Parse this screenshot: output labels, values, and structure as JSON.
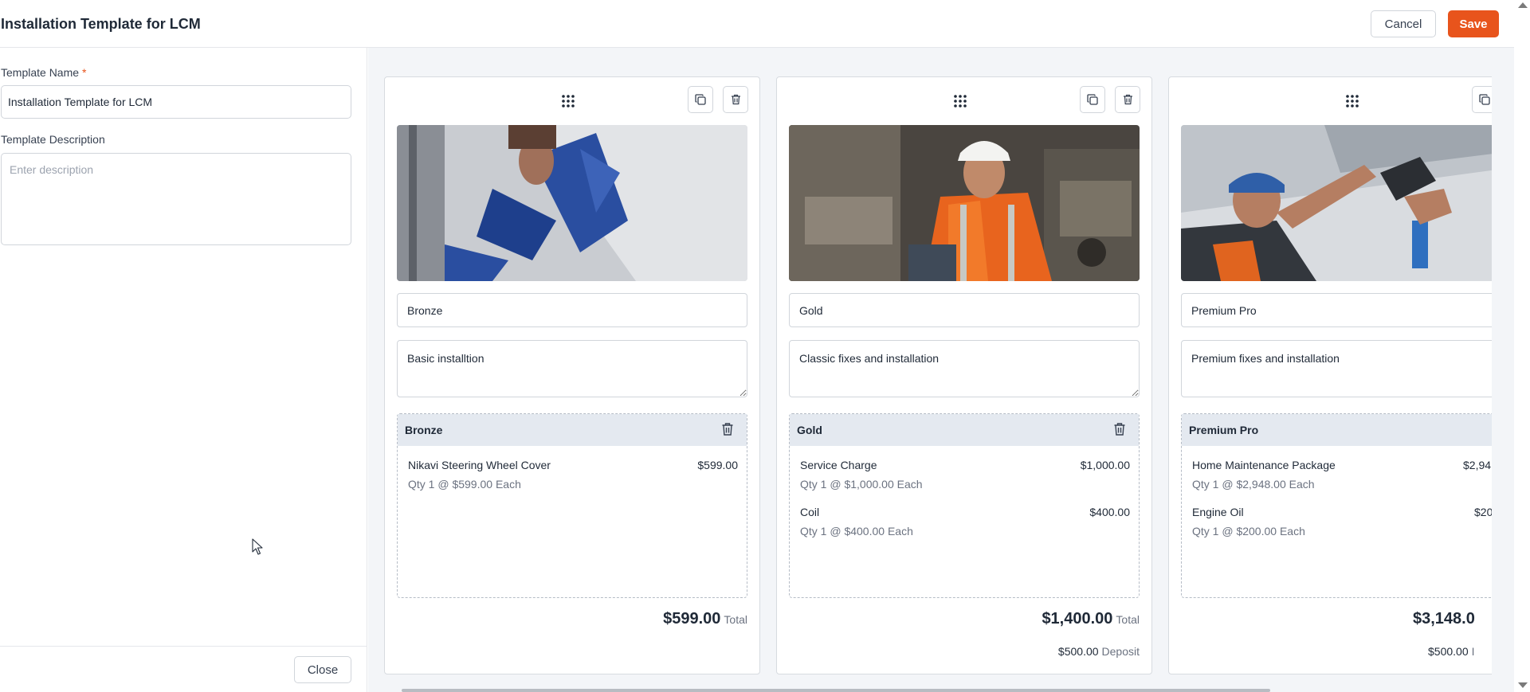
{
  "header": {
    "title": "Installation Template for LCM",
    "cancel_label": "Cancel",
    "save_label": "Save",
    "accent_color": "#e8541c"
  },
  "form": {
    "name_label": "Template Name",
    "required_mark": "*",
    "name_value": "Installation Template for LCM",
    "description_label": "Template Description",
    "description_value": "",
    "description_placeholder": "Enter description",
    "close_label": "Close"
  },
  "cards": [
    {
      "image": "technician-installing-signage-photo",
      "name_value": "Bronze",
      "description_value": "Basic installtion",
      "items_title": "Bronze",
      "items": [
        {
          "name": "Nikavi Steering Wheel Cover",
          "price": "$599.00",
          "qty": "Qty 1 @ $599.00 Each"
        }
      ],
      "total_value": "$599.00",
      "total_label": "Total"
    },
    {
      "image": "worker-at-lathe-machine-photo",
      "name_value": "Gold",
      "description_value": "Classic fixes and installation",
      "items_title": "Gold",
      "items": [
        {
          "name": "Service Charge",
          "price": "$1,000.00",
          "qty": "Qty 1 @ $1,000.00 Each"
        },
        {
          "name": "Coil",
          "price": "$400.00",
          "qty": "Qty 1 @ $400.00 Each"
        }
      ],
      "total_value": "$1,400.00",
      "total_label": "Total",
      "deposit_value": "$500.00",
      "deposit_label": "Deposit"
    },
    {
      "image": "electrician-drilling-ceiling-photo",
      "name_value": "Premium Pro",
      "description_value": "Premium fixes and installation",
      "items_title": "Premium Pro",
      "items": [
        {
          "name": "Home Maintenance Package",
          "price": "$2,94",
          "qty": "Qty 1 @ $2,948.00 Each"
        },
        {
          "name": "Engine Oil",
          "price": "$20",
          "qty": "Qty 1 @ $200.00 Each"
        }
      ],
      "total_value": "$3,148.0",
      "total_label": "",
      "deposit_value": "$500.00",
      "deposit_label": "I"
    }
  ],
  "icons": {
    "drag": "drag-handle-icon",
    "copy": "copy-icon",
    "trash": "trash-icon"
  }
}
